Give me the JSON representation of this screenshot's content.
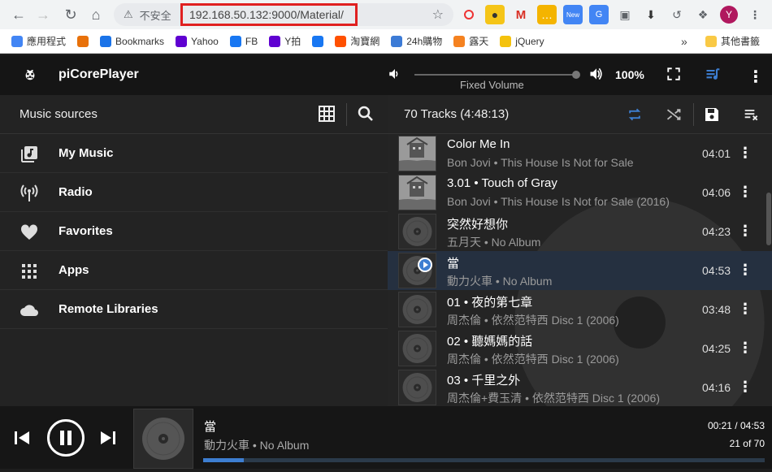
{
  "browser": {
    "security_label": "不安全",
    "url": "192.168.50.132:9000/Material/",
    "profile_initial": "Y"
  },
  "bookmarks": [
    {
      "label": "應用程式",
      "color": "#4285f4"
    },
    {
      "label": "",
      "color": "#e8710a"
    },
    {
      "label": "Bookmarks",
      "color": "#1a73e8"
    },
    {
      "label": "Yahoo",
      "color": "#5f01d1"
    },
    {
      "label": "FB",
      "color": "#1877f2"
    },
    {
      "label": "Y拍",
      "color": "#5f01d1"
    },
    {
      "label": "",
      "color": "#1877f2"
    },
    {
      "label": "淘寶網",
      "color": "#ff5000"
    },
    {
      "label": "24h購物",
      "color": "#3c7bd6"
    },
    {
      "label": "露天",
      "color": "#f58220"
    },
    {
      "label": "jQuery",
      "color": "#f4c20d"
    }
  ],
  "bookmarks_more": "»",
  "bookmarks_other": "其他書籤",
  "app": {
    "title": "piCorePlayer",
    "volume_label": "Fixed Volume",
    "volume_percent": "100%"
  },
  "browse": {
    "title": "Music sources",
    "items": [
      {
        "label": "My Music",
        "icon": "library-music-icon"
      },
      {
        "label": "Radio",
        "icon": "radio-tower-icon"
      },
      {
        "label": "Favorites",
        "icon": "heart-icon"
      },
      {
        "label": "Apps",
        "icon": "apps-grid-icon"
      },
      {
        "label": "Remote Libraries",
        "icon": "cloud-icon"
      }
    ]
  },
  "queue": {
    "header": "70 Tracks (4:48:13)",
    "tracks": [
      {
        "title": "Color Me In",
        "subtitle": "Bon Jovi • This House Is Not for Sale",
        "duration": "04:01",
        "art": true,
        "active": false
      },
      {
        "title": "3.01 • Touch of Gray",
        "subtitle": "Bon Jovi • This House Is Not for Sale (2016)",
        "duration": "04:06",
        "art": true,
        "active": false
      },
      {
        "title": "突然好想你",
        "subtitle": "五月天 • No Album",
        "duration": "04:23",
        "art": false,
        "active": false
      },
      {
        "title": "當",
        "subtitle": "動力火車 • No Album",
        "duration": "04:53",
        "art": false,
        "active": true
      },
      {
        "title": "01 • 夜的第七章",
        "subtitle": "周杰倫 • 依然范特西 Disc 1 (2006)",
        "duration": "03:48",
        "art": false,
        "active": false
      },
      {
        "title": "02 • 聽媽媽的話",
        "subtitle": "周杰倫 • 依然范特西 Disc 1 (2006)",
        "duration": "04:25",
        "art": false,
        "active": false
      },
      {
        "title": "03 • 千里之外",
        "subtitle": "周杰倫+費玉清 • 依然范特西 Disc 1 (2006)",
        "duration": "04:16",
        "art": false,
        "active": false
      }
    ]
  },
  "now_playing": {
    "title": "當",
    "artist": "動力火車 • No Album",
    "time": "00:21 / 04:53",
    "position": "21 of 70",
    "progress": 0.072
  },
  "colors": {
    "accent": "#3d7ed1",
    "header_bg": "#151515",
    "pane_bg": "#232323",
    "active_row": "#253040"
  }
}
